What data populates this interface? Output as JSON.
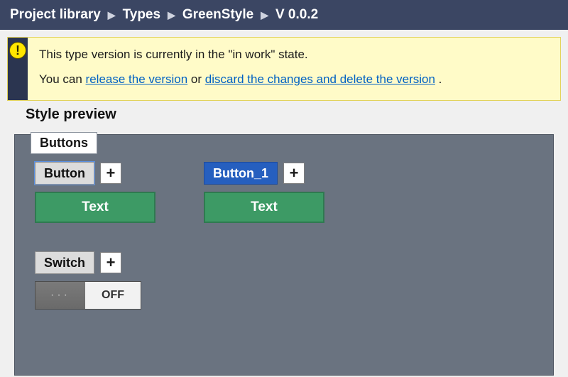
{
  "breadcrumb": {
    "items": [
      "Project library",
      "Types",
      "GreenStyle",
      "V 0.0.2"
    ]
  },
  "notice": {
    "line1": "This type version is currently in the \"in work\" state.",
    "line2_pre": "You can ",
    "link_release": "release the version",
    "line2_mid": " or ",
    "link_discard": "discard the changes and delete the version",
    "line2_end": " ."
  },
  "section_title": "Style preview",
  "panel": {
    "tab": "Buttons",
    "widgets": {
      "button_a": {
        "label": "Button",
        "plus": "+",
        "sample": "Text"
      },
      "button_b": {
        "label": "Button_1",
        "plus": "+",
        "sample": "Text"
      },
      "switch": {
        "label": "Switch",
        "plus": "+",
        "handle": "···",
        "state": "OFF"
      }
    }
  },
  "icons": {
    "warning_glyph": "!"
  }
}
